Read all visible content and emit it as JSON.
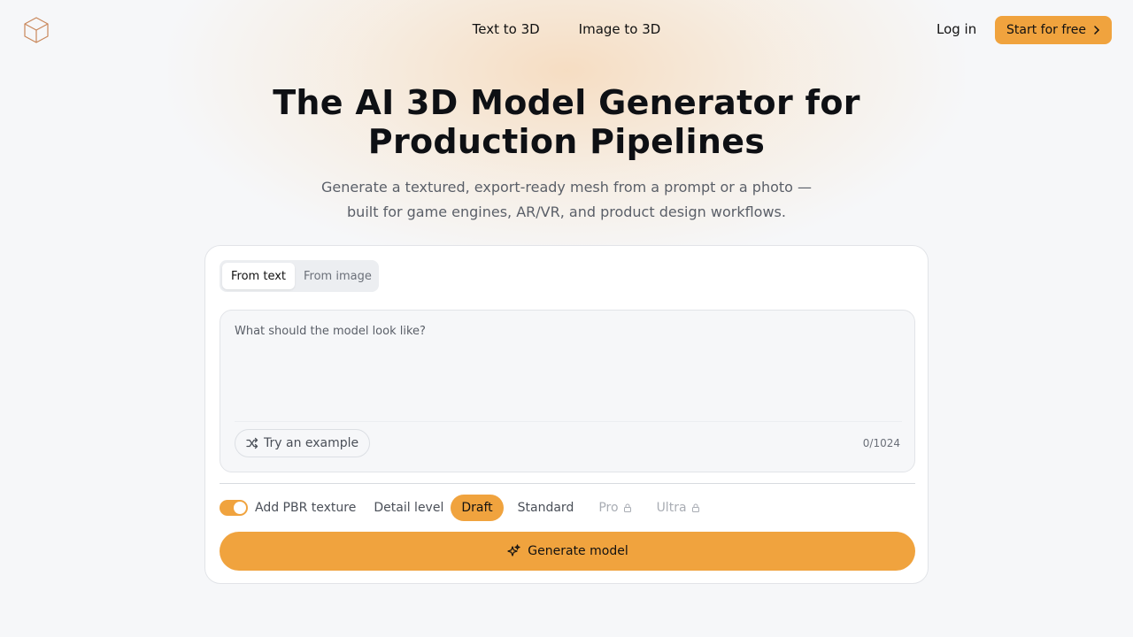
{
  "nav": {
    "logo_icon": "cube-icon",
    "links": [
      "Text to 3D",
      "Image to 3D"
    ],
    "login_label": "Log in",
    "start_label": "Start for free"
  },
  "hero": {
    "title_line1": "The AI 3D Model Generator for",
    "title_line2": "Production Pipelines",
    "subtitle_line1": "Generate a textured, export-ready mesh from a prompt or a photo —",
    "subtitle_line2": "built for game engines, AR/VR, and product design workflows."
  },
  "card": {
    "tabs": [
      {
        "label": "From text",
        "active": true
      },
      {
        "label": "From image",
        "active": false
      }
    ],
    "prompt": {
      "placeholder": "What should the model look like?",
      "value": "",
      "counter": "0/1024",
      "example_label": "Try an example",
      "example_icon": "shuffle-icon"
    },
    "options": {
      "pbr_toggle_on": true,
      "pbr_label": "Add PBR texture",
      "detail_label": "Detail level",
      "levels": [
        {
          "label": "Draft",
          "active": true,
          "locked": false
        },
        {
          "label": "Standard",
          "active": false,
          "locked": false
        },
        {
          "label": "Pro",
          "active": false,
          "locked": true
        },
        {
          "label": "Ultra",
          "active": false,
          "locked": true
        }
      ]
    },
    "generate_label": "Generate model",
    "generate_icon": "sparkles-icon"
  },
  "colors": {
    "accent": "#f0a33e",
    "background": "#f6f7f9"
  }
}
